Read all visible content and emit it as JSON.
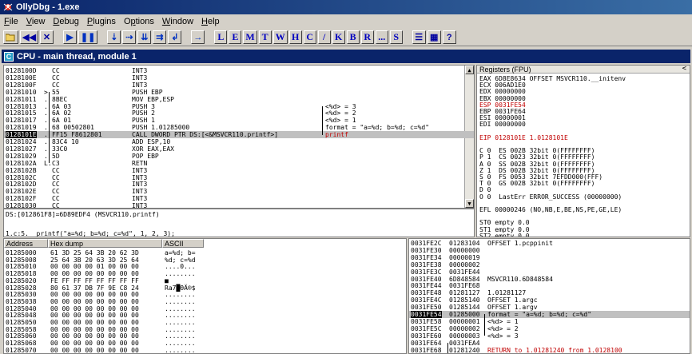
{
  "window": {
    "title": "OllyDbg - 1.exe"
  },
  "menu": [
    "File",
    "View",
    "Debug",
    "Plugins",
    "Options",
    "Window",
    "Help"
  ],
  "toolbar": {
    "letters": [
      "L",
      "E",
      "M",
      "T",
      "W",
      "H",
      "C",
      "/",
      "K",
      "B",
      "R",
      "...",
      "S"
    ]
  },
  "cpu_title": "CPU - main thread, module 1",
  "disasm": [
    {
      "addr": "0128100D",
      "mark": "",
      "hex": "CC",
      "instr": "INT3",
      "comment": ""
    },
    {
      "addr": "0128100E",
      "mark": "",
      "hex": "CC",
      "instr": "INT3",
      "comment": ""
    },
    {
      "addr": "0128100F",
      "mark": "",
      "hex": "CC",
      "instr": "INT3",
      "comment": ""
    },
    {
      "addr": "01281010",
      "mark": ">",
      "hex": "55",
      "instr": "PUSH EBP",
      "comment": ""
    },
    {
      "addr": "01281011",
      "mark": ".",
      "hex": "8BEC",
      "instr": "MOV EBP,ESP",
      "comment": ""
    },
    {
      "addr": "01281013",
      "mark": ".",
      "hex": "6A 03",
      "instr": "PUSH 3",
      "comment": "<%d> = 3"
    },
    {
      "addr": "01281015",
      "mark": ".",
      "hex": "6A 02",
      "instr": "PUSH 2",
      "comment": "<%d> = 2"
    },
    {
      "addr": "01281017",
      "mark": ".",
      "hex": "6A 01",
      "instr": "PUSH 1",
      "comment": "<%d> = 1"
    },
    {
      "addr": "01281019",
      "mark": ".",
      "hex": "68 00502801",
      "instr": "PUSH 1.01285000",
      "comment": "format = \"a=%d; b=%d; c=%d\""
    },
    {
      "addr": "0128101E",
      "mark": ".",
      "hex": "FF15 F8612801",
      "instr": "CALL DWORD PTR DS:[<&MSVCR110.printf>]",
      "comment": "printf"
    },
    {
      "addr": "01281024",
      "mark": ".",
      "hex": "83C4 10",
      "instr": "ADD ESP,10",
      "comment": ""
    },
    {
      "addr": "01281027",
      "mark": ".",
      "hex": "33C0",
      "instr": "XOR EAX,EAX",
      "comment": ""
    },
    {
      "addr": "01281029",
      "mark": ".",
      "hex": "5D",
      "instr": "POP EBP",
      "comment": ""
    },
    {
      "addr": "0128102A",
      "mark": "L.",
      "hex": "C3",
      "instr": "RETN",
      "comment": ""
    },
    {
      "addr": "0128102B",
      "mark": "",
      "hex": "CC",
      "instr": "INT3",
      "comment": ""
    },
    {
      "addr": "0128102C",
      "mark": "",
      "hex": "CC",
      "instr": "INT3",
      "comment": ""
    },
    {
      "addr": "0128102D",
      "mark": "",
      "hex": "CC",
      "instr": "INT3",
      "comment": ""
    },
    {
      "addr": "0128102E",
      "mark": "",
      "hex": "CC",
      "instr": "INT3",
      "comment": ""
    },
    {
      "addr": "0128102F",
      "mark": "",
      "hex": "CC",
      "instr": "INT3",
      "comment": ""
    },
    {
      "addr": "01281030",
      "mark": "",
      "hex": "CC",
      "instr": "INT3",
      "comment": ""
    }
  ],
  "info": {
    "line1": "DS:[012861F8]=6D89EDF4 (MSVCR110.printf)",
    "line2": "1.c:5.  printf(\"a=%d; b=%d; c=%d\", 1, 2, 3);"
  },
  "registers": {
    "header": "Registers (FPU)",
    "lines": [
      {
        "text": "EAX 6D8E8634 OFFSET MSVCR110.__initenv",
        "hl": false
      },
      {
        "text": "ECX 006AD1E0",
        "hl": false
      },
      {
        "text": "EDX 00000000",
        "hl": false
      },
      {
        "text": "EBX 00000000",
        "hl": false
      },
      {
        "text": "ESP 0031FE54",
        "hl": true
      },
      {
        "text": "EBP 0031FE64",
        "hl": false
      },
      {
        "text": "ESI 00000001",
        "hl": false
      },
      {
        "text": "EDI 00000000",
        "hl": false
      },
      {
        "text": "",
        "hl": false
      },
      {
        "text": "EIP 0128101E 1.0128101E",
        "hl": false
      },
      {
        "text": "",
        "hl": false
      },
      {
        "text": "C 0  ES 002B 32bit 0(FFFFFFFF)",
        "hl": false
      },
      {
        "text": "P 1  CS 0023 32bit 0(FFFFFFFF)",
        "hl": false
      },
      {
        "text": "A 0  SS 002B 32bit 0(FFFFFFFF)",
        "hl": false
      },
      {
        "text": "Z 1  DS 002B 32bit 0(FFFFFFFF)",
        "hl": false
      },
      {
        "text": "S 0  FS 0053 32bit 7EFDD000(FFF)",
        "hl": false
      },
      {
        "text": "T 0  GS 002B 32bit 0(FFFFFFFF)",
        "hl": false
      },
      {
        "text": "D 0",
        "hl": false
      },
      {
        "text": "O 0  LastErr ERROR_SUCCESS (00000000)",
        "hl": false
      },
      {
        "text": "",
        "hl": false
      },
      {
        "text": "EFL 00000246 (NO,NB,E,BE,NS,PE,GE,LE)",
        "hl": false
      },
      {
        "text": "",
        "hl": false
      },
      {
        "text": "ST0 empty 0.0",
        "hl": false
      },
      {
        "text": "ST1 empty 0.0",
        "hl": false
      },
      {
        "text": "ST2 empty 0.0",
        "hl": false
      }
    ]
  },
  "dump": {
    "headers": [
      "Address",
      "Hex dump",
      "ASCII"
    ],
    "rows": [
      {
        "addr": "01285000",
        "hex": "61 3D 25 64 3B 20 62 3D",
        "ascii": "a=%d; b="
      },
      {
        "addr": "01285008",
        "hex": "25 64 3B 20 63 3D 25 64",
        "ascii": "%d; c=%d"
      },
      {
        "addr": "01285010",
        "hex": "00 00 00 00 01 00 00 00",
        "ascii": "....0..."
      },
      {
        "addr": "01285018",
        "hex": "00 00 00 00 00 00 00 00",
        "ascii": "........"
      },
      {
        "addr": "01285020",
        "hex": "FE FF FF FF FF FF FF FF",
        "ascii": "■"
      },
      {
        "addr": "01285028",
        "hex": "80 61 37 DB 7F 9E C8 24",
        "ascii": "Ra7█ΘÄ®$"
      },
      {
        "addr": "01285030",
        "hex": "00 00 00 00 00 00 00 00",
        "ascii": "........"
      },
      {
        "addr": "01285038",
        "hex": "00 00 00 00 00 00 00 00",
        "ascii": "........"
      },
      {
        "addr": "01285040",
        "hex": "00 00 00 00 00 00 00 00",
        "ascii": "........"
      },
      {
        "addr": "01285048",
        "hex": "00 00 00 00 00 00 00 00",
        "ascii": "........"
      },
      {
        "addr": "01285050",
        "hex": "00 00 00 00 00 00 00 00",
        "ascii": "........"
      },
      {
        "addr": "01285058",
        "hex": "00 00 00 00 00 00 00 00",
        "ascii": "........"
      },
      {
        "addr": "01285060",
        "hex": "00 00 00 00 00 00 00 00",
        "ascii": "........"
      },
      {
        "addr": "01285068",
        "hex": "00 00 00 00 00 00 00 00",
        "ascii": "........"
      },
      {
        "addr": "01285070",
        "hex": "00 00 00 00 00 00 00 00",
        "ascii": "........"
      }
    ]
  },
  "stack": [
    {
      "addr": "0031FE2C",
      "val": "01283104",
      "comment": "OFFSET 1.pcppinit",
      "hl": false
    },
    {
      "addr": "0031FE30",
      "val": "00000000",
      "comment": "",
      "hl": false
    },
    {
      "addr": "0031FE34",
      "val": "00000019",
      "comment": "",
      "hl": false
    },
    {
      "addr": "0031FE38",
      "val": "00000002",
      "comment": "",
      "hl": false
    },
    {
      "addr": "0031FE3C",
      "val": "0031FE44",
      "comment": "",
      "hl": false
    },
    {
      "addr": "0031FE40",
      "val": "6D848584",
      "comment": "MSVCR110.6D848584",
      "hl": false
    },
    {
      "addr": "0031FE44",
      "val": "0031FE68",
      "comment": "",
      "hl": false
    },
    {
      "addr": "0031FE48",
      "val": "01281127",
      "comment": "1.01281127",
      "hl": false
    },
    {
      "addr": "0031FE4C",
      "val": "01285140",
      "comment": "OFFSET 1.argc",
      "hl": false
    },
    {
      "addr": "0031FE50",
      "val": "01285144",
      "comment": "OFFSET 1.argv",
      "hl": false
    },
    {
      "addr": "0031FE54",
      "val": "01285000",
      "comment": "format = \"a=%d; b=%d; c=%d\"",
      "hl": true
    },
    {
      "addr": "0031FE58",
      "val": "00000001",
      "comment": "<%d> = 1",
      "hl": false
    },
    {
      "addr": "0031FE5C",
      "val": "00000002",
      "comment": "<%d> = 2",
      "hl": false
    },
    {
      "addr": "0031FE60",
      "val": "00000003",
      "comment": "<%d> = 3",
      "hl": false
    },
    {
      "addr": "0031FE64",
      "val": "0031FEA4",
      "comment": "",
      "hl": false
    },
    {
      "addr": "0031FE68",
      "val": "01281240",
      "comment": "RETURN to 1.01281240 from 1.0128100",
      "hl": false
    }
  ]
}
